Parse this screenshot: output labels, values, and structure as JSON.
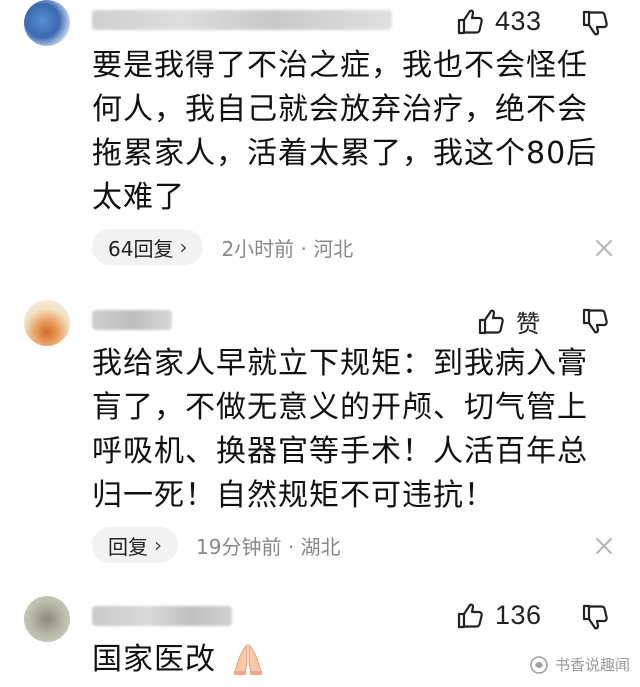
{
  "comments": [
    {
      "likes": "433",
      "text": "要是我得了不治之症，我也不会怪任何人，我自己就会放弃治疗，绝不会拖累家人，活着太累了，我这个80后太难了",
      "reply_label": "64回复",
      "meta": "2小时前 · 河北"
    },
    {
      "likes": "赞",
      "text": "我给家人早就立下规矩：到我病入膏肓了，不做无意义的开颅、切气管上呼吸机、换器官等手术！人活百年总归一死！自然规矩不可违抗！",
      "reply_label": "回复",
      "meta": "19分钟前 · 湖北"
    },
    {
      "likes": "136",
      "text": "国家医改"
    }
  ],
  "watermark": "书香说趣闻",
  "icons": {
    "like": "thumbs-up-icon",
    "dislike": "thumbs-down-icon",
    "close": "close-icon",
    "chevron": "chevron-right-icon",
    "emoji": "folded-hands-icon"
  }
}
